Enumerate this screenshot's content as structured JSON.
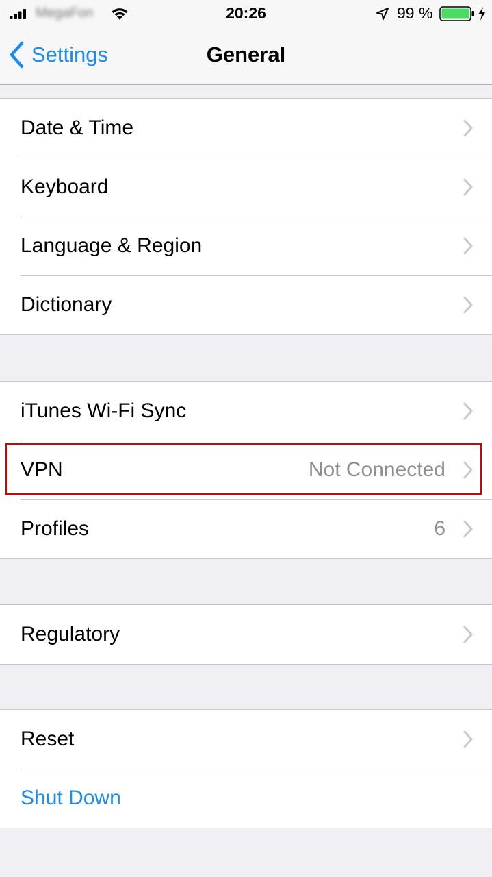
{
  "status_bar": {
    "carrier": "MegaFon",
    "time": "20:26",
    "battery_percent": "99 %",
    "icons": [
      "signal-bars-icon",
      "wifi-icon",
      "location-arrow-icon",
      "battery-icon",
      "charging-bolt-icon"
    ],
    "battery_color": "#4cd964"
  },
  "nav": {
    "back_label": "Settings",
    "title": "General",
    "accent": "#1a8cf0"
  },
  "groups": [
    {
      "rows": [
        {
          "label": "Date & Time",
          "value": ""
        },
        {
          "label": "Keyboard",
          "value": ""
        },
        {
          "label": "Language & Region",
          "value": ""
        },
        {
          "label": "Dictionary",
          "value": ""
        }
      ]
    },
    {
      "rows": [
        {
          "label": "iTunes Wi-Fi Sync",
          "value": ""
        },
        {
          "label": "VPN",
          "value": "Not Connected",
          "highlighted": true
        },
        {
          "label": "Profiles",
          "value": "6"
        }
      ]
    },
    {
      "rows": [
        {
          "label": "Regulatory",
          "value": ""
        }
      ]
    },
    {
      "rows": [
        {
          "label": "Reset",
          "value": ""
        },
        {
          "label": "Shut Down",
          "value": "",
          "style": "action"
        }
      ]
    }
  ],
  "highlight_color": "#d40000"
}
